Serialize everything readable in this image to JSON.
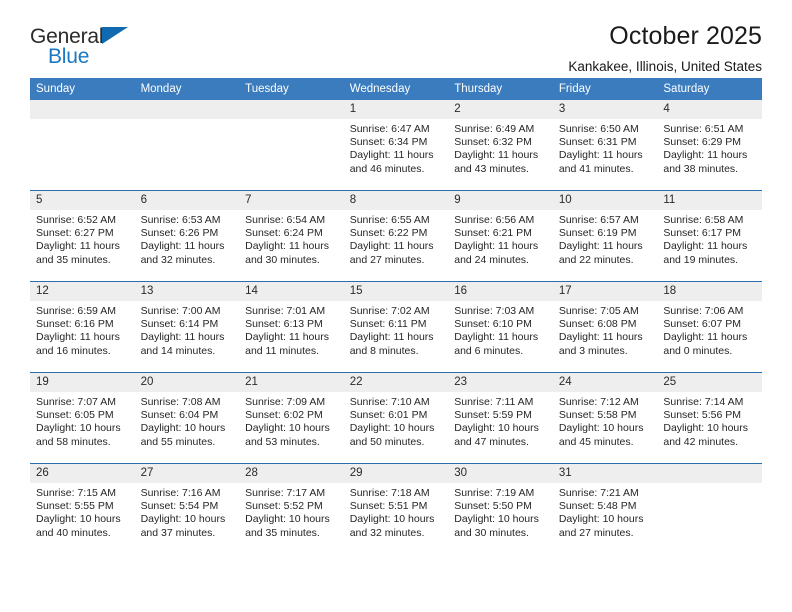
{
  "brand": {
    "name_top": "General",
    "name_bottom": "Blue",
    "accent_color": "#1b79c3",
    "triangle_color": "#0f6ab0"
  },
  "header": {
    "title": "October 2025",
    "location": "Kankakee, Illinois, United States"
  },
  "theme": {
    "header_bg": "#3a7cbe",
    "row_divider": "#2a6ead",
    "daynum_bg": "#eeeeee"
  },
  "weekday_headers": [
    "Sunday",
    "Monday",
    "Tuesday",
    "Wednesday",
    "Thursday",
    "Friday",
    "Saturday"
  ],
  "weeks": [
    [
      {
        "day": "",
        "sunrise": "",
        "sunset": "",
        "daylight_line1": "",
        "daylight_line2": ""
      },
      {
        "day": "",
        "sunrise": "",
        "sunset": "",
        "daylight_line1": "",
        "daylight_line2": ""
      },
      {
        "day": "",
        "sunrise": "",
        "sunset": "",
        "daylight_line1": "",
        "daylight_line2": ""
      },
      {
        "day": "1",
        "sunrise": "Sunrise: 6:47 AM",
        "sunset": "Sunset: 6:34 PM",
        "daylight_line1": "Daylight: 11 hours",
        "daylight_line2": "and 46 minutes."
      },
      {
        "day": "2",
        "sunrise": "Sunrise: 6:49 AM",
        "sunset": "Sunset: 6:32 PM",
        "daylight_line1": "Daylight: 11 hours",
        "daylight_line2": "and 43 minutes."
      },
      {
        "day": "3",
        "sunrise": "Sunrise: 6:50 AM",
        "sunset": "Sunset: 6:31 PM",
        "daylight_line1": "Daylight: 11 hours",
        "daylight_line2": "and 41 minutes."
      },
      {
        "day": "4",
        "sunrise": "Sunrise: 6:51 AM",
        "sunset": "Sunset: 6:29 PM",
        "daylight_line1": "Daylight: 11 hours",
        "daylight_line2": "and 38 minutes."
      }
    ],
    [
      {
        "day": "5",
        "sunrise": "Sunrise: 6:52 AM",
        "sunset": "Sunset: 6:27 PM",
        "daylight_line1": "Daylight: 11 hours",
        "daylight_line2": "and 35 minutes."
      },
      {
        "day": "6",
        "sunrise": "Sunrise: 6:53 AM",
        "sunset": "Sunset: 6:26 PM",
        "daylight_line1": "Daylight: 11 hours",
        "daylight_line2": "and 32 minutes."
      },
      {
        "day": "7",
        "sunrise": "Sunrise: 6:54 AM",
        "sunset": "Sunset: 6:24 PM",
        "daylight_line1": "Daylight: 11 hours",
        "daylight_line2": "and 30 minutes."
      },
      {
        "day": "8",
        "sunrise": "Sunrise: 6:55 AM",
        "sunset": "Sunset: 6:22 PM",
        "daylight_line1": "Daylight: 11 hours",
        "daylight_line2": "and 27 minutes."
      },
      {
        "day": "9",
        "sunrise": "Sunrise: 6:56 AM",
        "sunset": "Sunset: 6:21 PM",
        "daylight_line1": "Daylight: 11 hours",
        "daylight_line2": "and 24 minutes."
      },
      {
        "day": "10",
        "sunrise": "Sunrise: 6:57 AM",
        "sunset": "Sunset: 6:19 PM",
        "daylight_line1": "Daylight: 11 hours",
        "daylight_line2": "and 22 minutes."
      },
      {
        "day": "11",
        "sunrise": "Sunrise: 6:58 AM",
        "sunset": "Sunset: 6:17 PM",
        "daylight_line1": "Daylight: 11 hours",
        "daylight_line2": "and 19 minutes."
      }
    ],
    [
      {
        "day": "12",
        "sunrise": "Sunrise: 6:59 AM",
        "sunset": "Sunset: 6:16 PM",
        "daylight_line1": "Daylight: 11 hours",
        "daylight_line2": "and 16 minutes."
      },
      {
        "day": "13",
        "sunrise": "Sunrise: 7:00 AM",
        "sunset": "Sunset: 6:14 PM",
        "daylight_line1": "Daylight: 11 hours",
        "daylight_line2": "and 14 minutes."
      },
      {
        "day": "14",
        "sunrise": "Sunrise: 7:01 AM",
        "sunset": "Sunset: 6:13 PM",
        "daylight_line1": "Daylight: 11 hours",
        "daylight_line2": "and 11 minutes."
      },
      {
        "day": "15",
        "sunrise": "Sunrise: 7:02 AM",
        "sunset": "Sunset: 6:11 PM",
        "daylight_line1": "Daylight: 11 hours",
        "daylight_line2": "and 8 minutes."
      },
      {
        "day": "16",
        "sunrise": "Sunrise: 7:03 AM",
        "sunset": "Sunset: 6:10 PM",
        "daylight_line1": "Daylight: 11 hours",
        "daylight_line2": "and 6 minutes."
      },
      {
        "day": "17",
        "sunrise": "Sunrise: 7:05 AM",
        "sunset": "Sunset: 6:08 PM",
        "daylight_line1": "Daylight: 11 hours",
        "daylight_line2": "and 3 minutes."
      },
      {
        "day": "18",
        "sunrise": "Sunrise: 7:06 AM",
        "sunset": "Sunset: 6:07 PM",
        "daylight_line1": "Daylight: 11 hours",
        "daylight_line2": "and 0 minutes."
      }
    ],
    [
      {
        "day": "19",
        "sunrise": "Sunrise: 7:07 AM",
        "sunset": "Sunset: 6:05 PM",
        "daylight_line1": "Daylight: 10 hours",
        "daylight_line2": "and 58 minutes."
      },
      {
        "day": "20",
        "sunrise": "Sunrise: 7:08 AM",
        "sunset": "Sunset: 6:04 PM",
        "daylight_line1": "Daylight: 10 hours",
        "daylight_line2": "and 55 minutes."
      },
      {
        "day": "21",
        "sunrise": "Sunrise: 7:09 AM",
        "sunset": "Sunset: 6:02 PM",
        "daylight_line1": "Daylight: 10 hours",
        "daylight_line2": "and 53 minutes."
      },
      {
        "day": "22",
        "sunrise": "Sunrise: 7:10 AM",
        "sunset": "Sunset: 6:01 PM",
        "daylight_line1": "Daylight: 10 hours",
        "daylight_line2": "and 50 minutes."
      },
      {
        "day": "23",
        "sunrise": "Sunrise: 7:11 AM",
        "sunset": "Sunset: 5:59 PM",
        "daylight_line1": "Daylight: 10 hours",
        "daylight_line2": "and 47 minutes."
      },
      {
        "day": "24",
        "sunrise": "Sunrise: 7:12 AM",
        "sunset": "Sunset: 5:58 PM",
        "daylight_line1": "Daylight: 10 hours",
        "daylight_line2": "and 45 minutes."
      },
      {
        "day": "25",
        "sunrise": "Sunrise: 7:14 AM",
        "sunset": "Sunset: 5:56 PM",
        "daylight_line1": "Daylight: 10 hours",
        "daylight_line2": "and 42 minutes."
      }
    ],
    [
      {
        "day": "26",
        "sunrise": "Sunrise: 7:15 AM",
        "sunset": "Sunset: 5:55 PM",
        "daylight_line1": "Daylight: 10 hours",
        "daylight_line2": "and 40 minutes."
      },
      {
        "day": "27",
        "sunrise": "Sunrise: 7:16 AM",
        "sunset": "Sunset: 5:54 PM",
        "daylight_line1": "Daylight: 10 hours",
        "daylight_line2": "and 37 minutes."
      },
      {
        "day": "28",
        "sunrise": "Sunrise: 7:17 AM",
        "sunset": "Sunset: 5:52 PM",
        "daylight_line1": "Daylight: 10 hours",
        "daylight_line2": "and 35 minutes."
      },
      {
        "day": "29",
        "sunrise": "Sunrise: 7:18 AM",
        "sunset": "Sunset: 5:51 PM",
        "daylight_line1": "Daylight: 10 hours",
        "daylight_line2": "and 32 minutes."
      },
      {
        "day": "30",
        "sunrise": "Sunrise: 7:19 AM",
        "sunset": "Sunset: 5:50 PM",
        "daylight_line1": "Daylight: 10 hours",
        "daylight_line2": "and 30 minutes."
      },
      {
        "day": "31",
        "sunrise": "Sunrise: 7:21 AM",
        "sunset": "Sunset: 5:48 PM",
        "daylight_line1": "Daylight: 10 hours",
        "daylight_line2": "and 27 minutes."
      },
      {
        "day": "",
        "sunrise": "",
        "sunset": "",
        "daylight_line1": "",
        "daylight_line2": ""
      }
    ]
  ]
}
